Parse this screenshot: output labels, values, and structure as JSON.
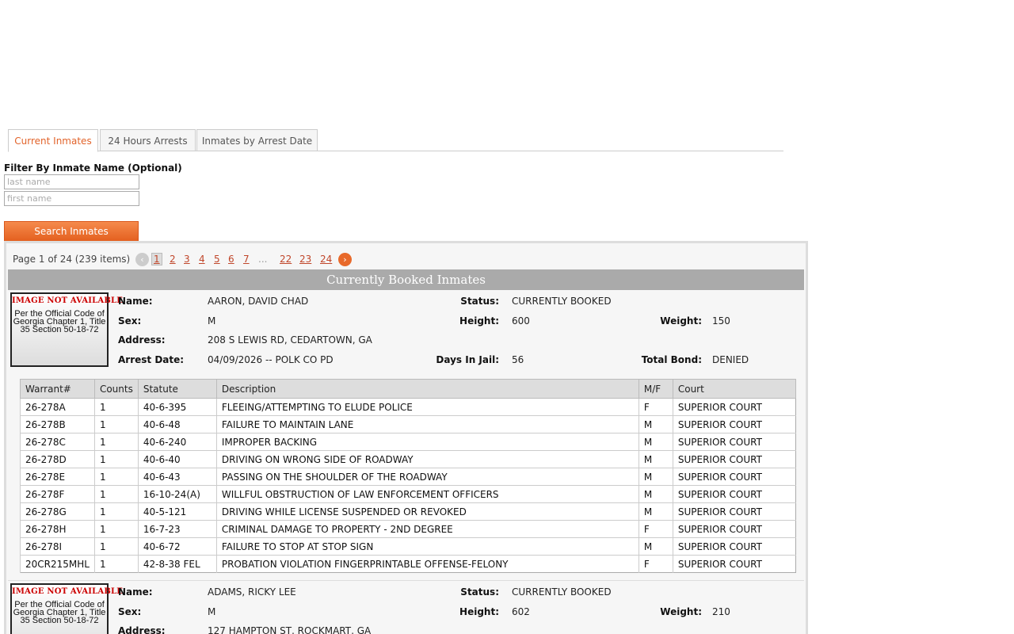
{
  "tabs": [
    {
      "label": "Current Inmates",
      "active": true
    },
    {
      "label": "24 Hours Arrests",
      "active": false
    },
    {
      "label": "Inmates by Arrest Date",
      "active": false
    }
  ],
  "filter": {
    "label": "Filter By Inmate Name (Optional)",
    "last_name_placeholder": "last name",
    "first_name_placeholder": "first name",
    "search_label": "Search Inmates"
  },
  "pager": {
    "info": "Page 1 of 24 (239 items)",
    "prev_icon": "chevron-left-icon",
    "next_icon": "chevron-right-icon",
    "prev_glyph": "‹",
    "next_glyph": "›",
    "pages": [
      "1",
      "2",
      "3",
      "4",
      "5",
      "6",
      "7",
      "...",
      "22",
      "23",
      "24"
    ],
    "current": "1"
  },
  "banner": "Currently Booked Inmates",
  "photo_placeholder": {
    "title": "IMAGE NOT AVAILABLE",
    "text": "Per the Official Code of Georgia Chapter 1, Title 35 Section 50-18-72"
  },
  "field_labels": {
    "name": "Name:",
    "sex": "Sex:",
    "address": "Address:",
    "arrest_date": "Arrest Date:",
    "status": "Status:",
    "height": "Height:",
    "days": "Days In Jail:",
    "weight": "Weight:",
    "bond": "Total Bond:"
  },
  "charge_headers": [
    "Warrant#",
    "Counts",
    "Statute",
    "Description",
    "M/F",
    "Court"
  ],
  "inmates": [
    {
      "name": "AARON, DAVID CHAD",
      "sex": "M",
      "address": "208 S LEWIS RD, CEDARTOWN, GA",
      "arrest_date": "04/09/2026 -- POLK CO PD",
      "status": "CURRENTLY BOOKED",
      "height": "600",
      "weight": "150",
      "days": "56",
      "bond": "DENIED",
      "charges": [
        [
          "26-278A",
          "1",
          "40-6-395",
          "FLEEING/ATTEMPTING TO ELUDE POLICE",
          "F",
          "SUPERIOR COURT"
        ],
        [
          "26-278B",
          "1",
          "40-6-48",
          "FAILURE TO MAINTAIN LANE",
          "M",
          "SUPERIOR COURT"
        ],
        [
          "26-278C",
          "1",
          "40-6-240",
          "IMPROPER BACKING",
          "M",
          "SUPERIOR COURT"
        ],
        [
          "26-278D",
          "1",
          "40-6-40",
          "DRIVING ON WRONG SIDE OF ROADWAY",
          "M",
          "SUPERIOR COURT"
        ],
        [
          "26-278E",
          "1",
          "40-6-43",
          "PASSING ON THE SHOULDER OF THE ROADWAY",
          "M",
          "SUPERIOR COURT"
        ],
        [
          "26-278F",
          "1",
          "16-10-24(A)",
          "WILLFUL OBSTRUCTION OF LAW ENFORCEMENT OFFICERS",
          "M",
          "SUPERIOR COURT"
        ],
        [
          "26-278G",
          "1",
          "40-5-121",
          "DRIVING WHILE LICENSE SUSPENDED OR REVOKED",
          "M",
          "SUPERIOR COURT"
        ],
        [
          "26-278H",
          "1",
          "16-7-23",
          "CRIMINAL DAMAGE TO PROPERTY - 2ND DEGREE",
          "F",
          "SUPERIOR COURT"
        ],
        [
          "26-278I",
          "1",
          "40-6-72",
          "FAILURE TO STOP AT STOP SIGN",
          "M",
          "SUPERIOR COURT"
        ],
        [
          "20CR215MHL",
          "1",
          "42-8-38 FEL",
          "PROBATION VIOLATION FINGERPRINTABLE OFFENSE-FELONY",
          "F",
          "SUPERIOR COURT"
        ]
      ]
    },
    {
      "name": "ADAMS, RICKY LEE",
      "sex": "M",
      "address": "127 HAMPTON ST, ROCKMART, GA",
      "status": "CURRENTLY BOOKED",
      "height": "602",
      "weight": "210"
    }
  ]
}
